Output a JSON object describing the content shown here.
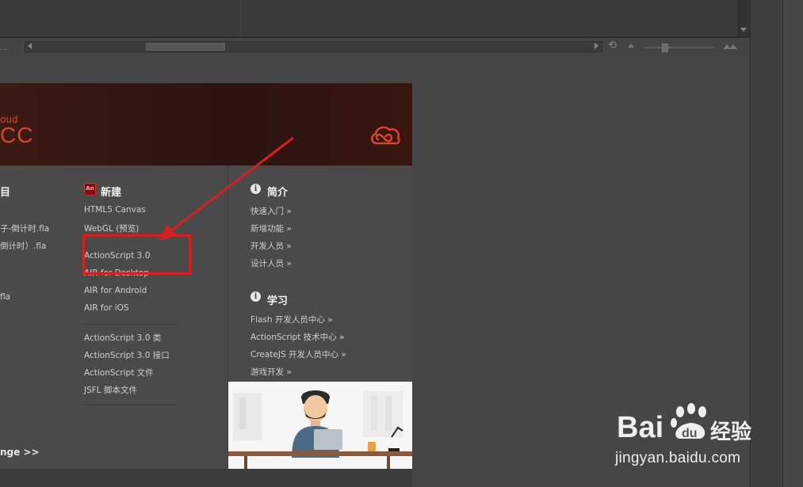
{
  "welcome": {
    "banner": {
      "cloud_text": "oud",
      "cc_text": "CC"
    },
    "recent": {
      "heading_partial": "目",
      "files": [
        "子-倒计时.fla",
        "倒计时）.fla",
        "fla"
      ],
      "more_link": "nge >>"
    },
    "create_new": {
      "icon_text": "An",
      "heading": "新建",
      "items_group1": [
        "HTML5 Canvas",
        "WebGL (预览)",
        "ActionScript 3.0",
        "AIR for Desktop",
        "AIR for Android",
        "AIR for iOS"
      ],
      "items_group2": [
        "ActionScript 3.0 类",
        "ActionScript 3.0 接口",
        "ActionScript 文件",
        "JSFL 脚本文件"
      ]
    },
    "intro": {
      "icon_text": "i",
      "heading": "简介",
      "links": [
        "快速入门 »",
        "新增功能 »",
        "开发人员 »",
        "设计人员 »"
      ]
    },
    "learn": {
      "icon_text": "i",
      "heading": "学习",
      "links": [
        "Flash 开发人员中心 »",
        "ActionScript 技术中心 »",
        "CreateJS 开发人员中心 »",
        "游戏开发 »"
      ]
    }
  },
  "toolbar": {
    "reset_icon": "reset-icon",
    "zoom_out_icon": "zoom-small-icon",
    "zoom_in_icon": "zoom-large-icon"
  },
  "watermark": {
    "logo_text": "Bai du 经验",
    "url": "jingyan.baidu.com"
  },
  "colors": {
    "accent_red": "#d42020",
    "cc_red": "#d9452f",
    "background": "#464646"
  }
}
